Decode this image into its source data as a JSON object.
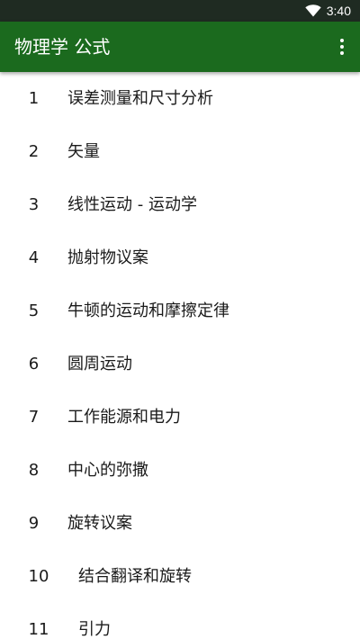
{
  "status_bar": {
    "time": "3:40",
    "wifi_icon": "wifi-icon"
  },
  "app_bar": {
    "title": "物理学 公式",
    "menu_icon": "more-vert-icon",
    "background": "#1b6a1e"
  },
  "list": {
    "items": [
      {
        "number": "1",
        "label": "误差测量和尺寸分析"
      },
      {
        "number": "2",
        "label": "矢量"
      },
      {
        "number": "3",
        "label": "线性运动 - 运动学"
      },
      {
        "number": "4",
        "label": "抛射物议案"
      },
      {
        "number": "5",
        "label": "牛顿的运动和摩擦定律"
      },
      {
        "number": "6",
        "label": "圆周运动"
      },
      {
        "number": "7",
        "label": "工作能源和电力"
      },
      {
        "number": "8",
        "label": "中心的弥撒"
      },
      {
        "number": "9",
        "label": "旋转议案"
      },
      {
        "number": "10",
        "label": "结合翻译和旋转"
      },
      {
        "number": "11",
        "label": "引力"
      }
    ]
  }
}
